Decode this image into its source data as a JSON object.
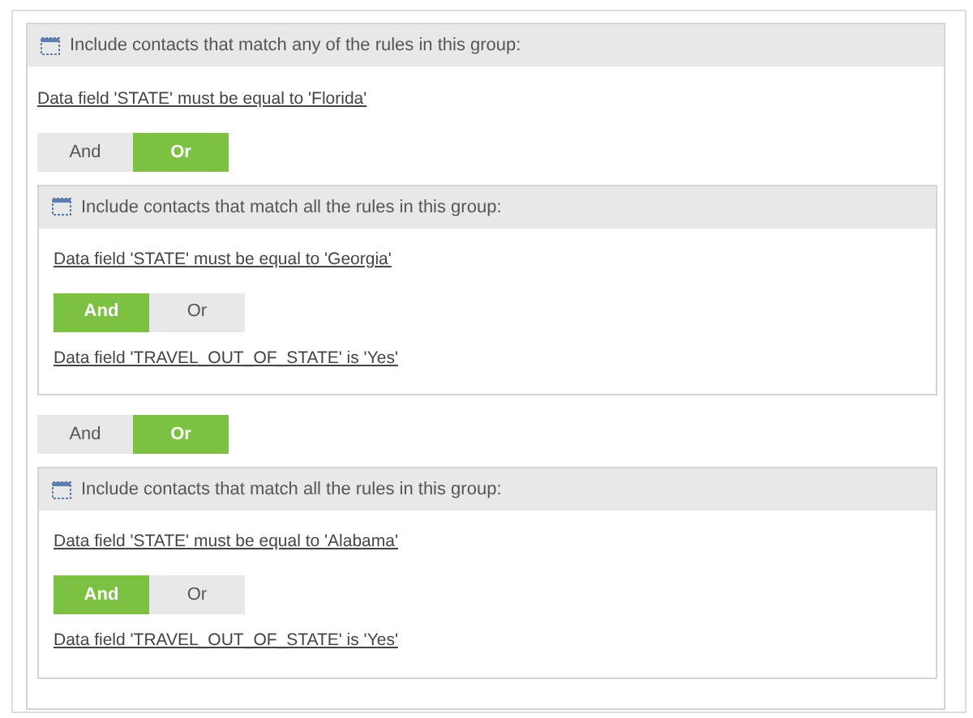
{
  "group": {
    "header": "Include contacts that match any of the rules in this group:",
    "items": [
      {
        "kind": "rule",
        "text": "Data field 'STATE' must be equal to 'Florida'"
      },
      {
        "kind": "toggle",
        "options": [
          {
            "label": "And",
            "selected": false
          },
          {
            "label": "Or",
            "selected": true
          }
        ]
      },
      {
        "kind": "group",
        "header": "Include contacts that match all the rules in this group:",
        "items": [
          {
            "kind": "rule",
            "text": "Data field 'STATE' must be equal to 'Georgia'"
          },
          {
            "kind": "toggle",
            "options": [
              {
                "label": "And",
                "selected": true
              },
              {
                "label": "Or",
                "selected": false
              }
            ]
          },
          {
            "kind": "rule",
            "text": "Data field 'TRAVEL_OUT_OF_STATE' is 'Yes'"
          }
        ]
      },
      {
        "kind": "toggle",
        "options": [
          {
            "label": "And",
            "selected": false
          },
          {
            "label": "Or",
            "selected": true
          }
        ]
      },
      {
        "kind": "group",
        "header": "Include contacts that match all the rules in this group:",
        "items": [
          {
            "kind": "rule",
            "text": "Data field 'STATE' must be equal to 'Alabama'"
          },
          {
            "kind": "toggle",
            "options": [
              {
                "label": "And",
                "selected": true
              },
              {
                "label": "Or",
                "selected": false
              }
            ]
          },
          {
            "kind": "rule",
            "text": "Data field 'TRAVEL_OUT_OF_STATE' is 'Yes'"
          }
        ]
      }
    ]
  }
}
